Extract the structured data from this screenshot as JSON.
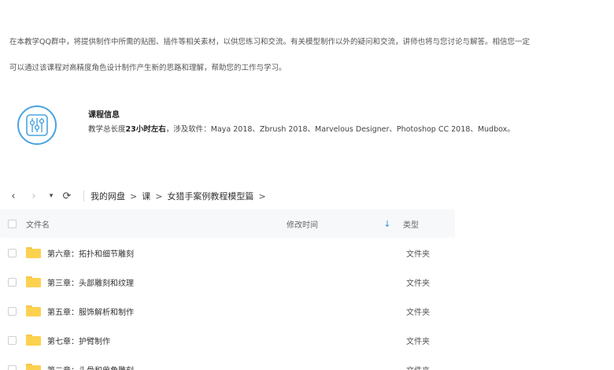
{
  "intro": {
    "line1": "在本教学QQ群中，将提供制作中所需的贴图、插件等相关素材，以供您练习和交流。有关模型制作以外的疑问和交流，讲师也将与您讨论与解答。相信您一定",
    "line2": "可以通过该课程对高精度角色设计制作产生新的思路和理解，帮助您的工作与学习。"
  },
  "course_info": {
    "icon": "equalizer-icon",
    "title": "课程信息",
    "desc_prefix": "教学总长度",
    "desc_duration": "23小时左右",
    "desc_suffix": "，涉及软件：Maya 2018、Zbrush 2018、Marvelous Designer、Photoshop CC 2018、Mudbox。"
  },
  "file_manager": {
    "nav": {
      "back": "‹",
      "forward": "›",
      "dropdown": "▾",
      "refresh": "⟳",
      "breadcrumbs": [
        "我的网盘",
        "课",
        "女猎手案例教程模型篇"
      ],
      "separator": ">"
    },
    "columns": {
      "name": "文件名",
      "modified": "修改时间",
      "sort_arrow": "↓",
      "type": "类型"
    },
    "rows": [
      {
        "name": "第六章：拓扑和细节雕刻",
        "type": "文件夹"
      },
      {
        "name": "第三章：头部雕刻和纹理",
        "type": "文件夹"
      },
      {
        "name": "第五章：服饰解析和制作",
        "type": "文件夹"
      },
      {
        "name": "第七章：护臂制作",
        "type": "文件夹"
      },
      {
        "name": "第二章：头骨和兽角雕刻",
        "type": "文件夹"
      }
    ],
    "colors": {
      "accent": "#3b8ee8",
      "folder": "#fdd150",
      "icon_ring": "#4aa3e0"
    }
  }
}
